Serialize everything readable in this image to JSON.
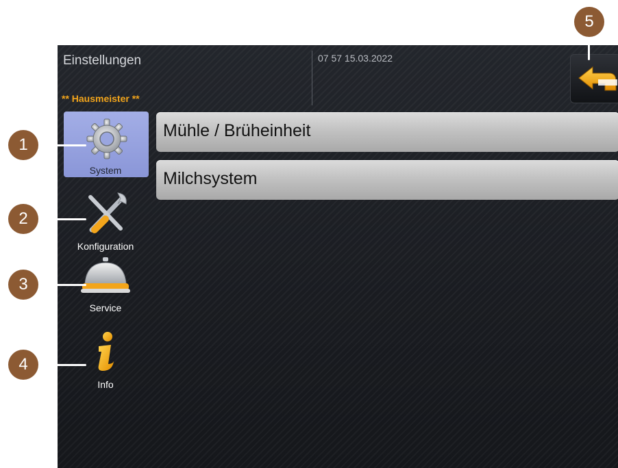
{
  "header": {
    "title": "Einstellungen",
    "datetime": "07 57 15.03.2022",
    "user_role": "** Hausmeister **"
  },
  "sidebar": {
    "items": [
      {
        "label": "System",
        "icon": "gear-icon",
        "active": true
      },
      {
        "label": "Konfiguration",
        "icon": "tools-icon",
        "active": false
      },
      {
        "label": "Service",
        "icon": "service-bell-icon",
        "active": false
      },
      {
        "label": "Info",
        "icon": "info-icon",
        "active": false
      }
    ]
  },
  "menu": {
    "items": [
      {
        "label": "Mühle / Brüheinheit"
      },
      {
        "label": "Milchsystem"
      }
    ]
  },
  "back_button": {
    "icon": "back-arrow-icon"
  },
  "callouts": [
    "1",
    "2",
    "3",
    "4",
    "5"
  ],
  "colors": {
    "accent": "#f3a51b",
    "active_nav": "#9aa6e0",
    "callout": "#8c5a33"
  }
}
